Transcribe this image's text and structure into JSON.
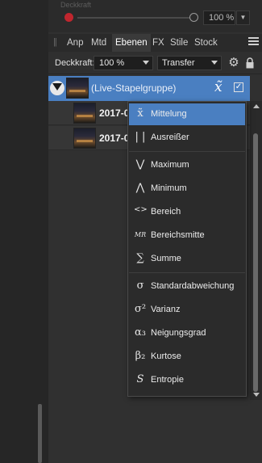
{
  "top": {
    "deckkraft_ghost": "Deckkraft",
    "percent_value": "100 %"
  },
  "tabs": [
    "Anp",
    "Mtd",
    "Ebenen",
    "FX",
    "Stile",
    "Stock"
  ],
  "opacity_row": {
    "label": "Deckkraft:",
    "value": "100 %",
    "blend_mode": "Transfer"
  },
  "layers": {
    "group_label": "(Live-Stapelgruppe)",
    "children": [
      "2017-0",
      "2017-0"
    ]
  },
  "menu": {
    "items": [
      {
        "icon": "x̃",
        "label": "Mittelung",
        "selected": true
      },
      {
        "icon": "| |",
        "label": "Ausreißer",
        "selected": false
      },
      {
        "icon": "⋁",
        "label": "Maximum",
        "selected": false
      },
      {
        "icon": "⋀",
        "label": "Minimum",
        "selected": false
      },
      {
        "icon": "<>",
        "label": "Bereich",
        "selected": false
      },
      {
        "icon": "MR",
        "label": "Bereichsmitte",
        "selected": false
      },
      {
        "icon": "∑",
        "label": "Summe",
        "selected": false
      },
      {
        "icon": "σ",
        "label": "Standardabweichung",
        "selected": false
      },
      {
        "icon": "σ²",
        "label": "Varianz",
        "selected": false
      },
      {
        "icon": "α₃",
        "label": "Neigungsgrad",
        "selected": false
      },
      {
        "icon": "β₂",
        "label": "Kurtose",
        "selected": false
      },
      {
        "icon": "S",
        "label": "Entropie",
        "selected": false
      }
    ]
  },
  "colors": {
    "accent": "#4a7fc1",
    "record": "#c0262e"
  }
}
